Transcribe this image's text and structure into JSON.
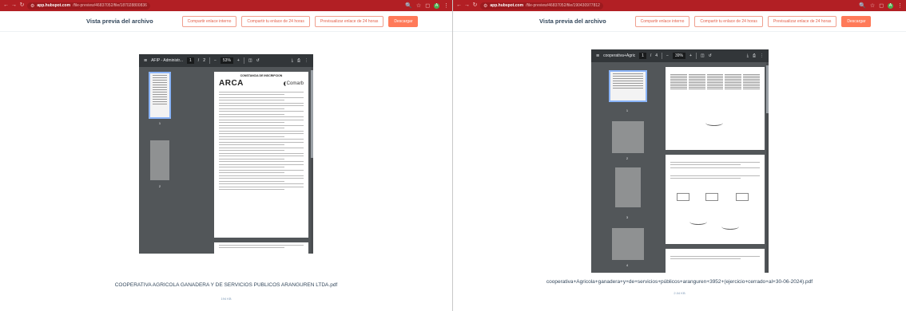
{
  "windows": [
    {
      "url_host": "app.hubspot.com",
      "url_path": "/file-preview/46837052/file/187028800836",
      "app_title": "Vista previa del archivo",
      "buttons": {
        "copy_internal": "Compartir enlace interno",
        "copy_24h": "Compartir tu enlace de 24 horas",
        "preview_24h": "Previsualizar enlace de 24 horas",
        "download": "Descargar"
      },
      "viewer": {
        "file_short": "AFIP - Administr...",
        "page_current": "1",
        "page_total": "2",
        "zoom": "53%",
        "thumb_labels": [
          "1",
          "2"
        ]
      },
      "doc": {
        "header": "CONSTANCIA DE INSCRIPCION",
        "logo_left": "ARCA",
        "logo_right": "Comarb"
      },
      "file_name": "COOPERATIVA AGRICOLA GANADERA Y DE SERVICIOS PUBLICOS ARANGUREN LTDA.pdf",
      "file_size": "194 KB"
    },
    {
      "url_host": "app.hubspot.com",
      "url_path": "/file-preview/46837052/file/190430977812",
      "app_title": "Vista previa del archivo",
      "buttons": {
        "copy_internal": "Compartir enlace interno",
        "copy_24h": "Compartir tu enlace de 24 horas",
        "preview_24h": "Previsualizar enlace de 24 horas",
        "download": "Descargar"
      },
      "viewer": {
        "file_short": "cooperativa+Agric...",
        "page_current": "1",
        "page_total": "4",
        "zoom": "39%",
        "thumb_labels": [
          "1",
          "2",
          "3",
          "4"
        ]
      },
      "file_name": "cooperativa+Agricola+ganadera+y+de+servicios+públicos+aranguren+3952+(ejercicio+cerrado+al+30-06-2024).pdf",
      "file_size": "2.04 KB"
    }
  ],
  "colors": {
    "chrome": "#b21f24",
    "accent": "#ff7a59",
    "viewer_bg": "#525659"
  }
}
